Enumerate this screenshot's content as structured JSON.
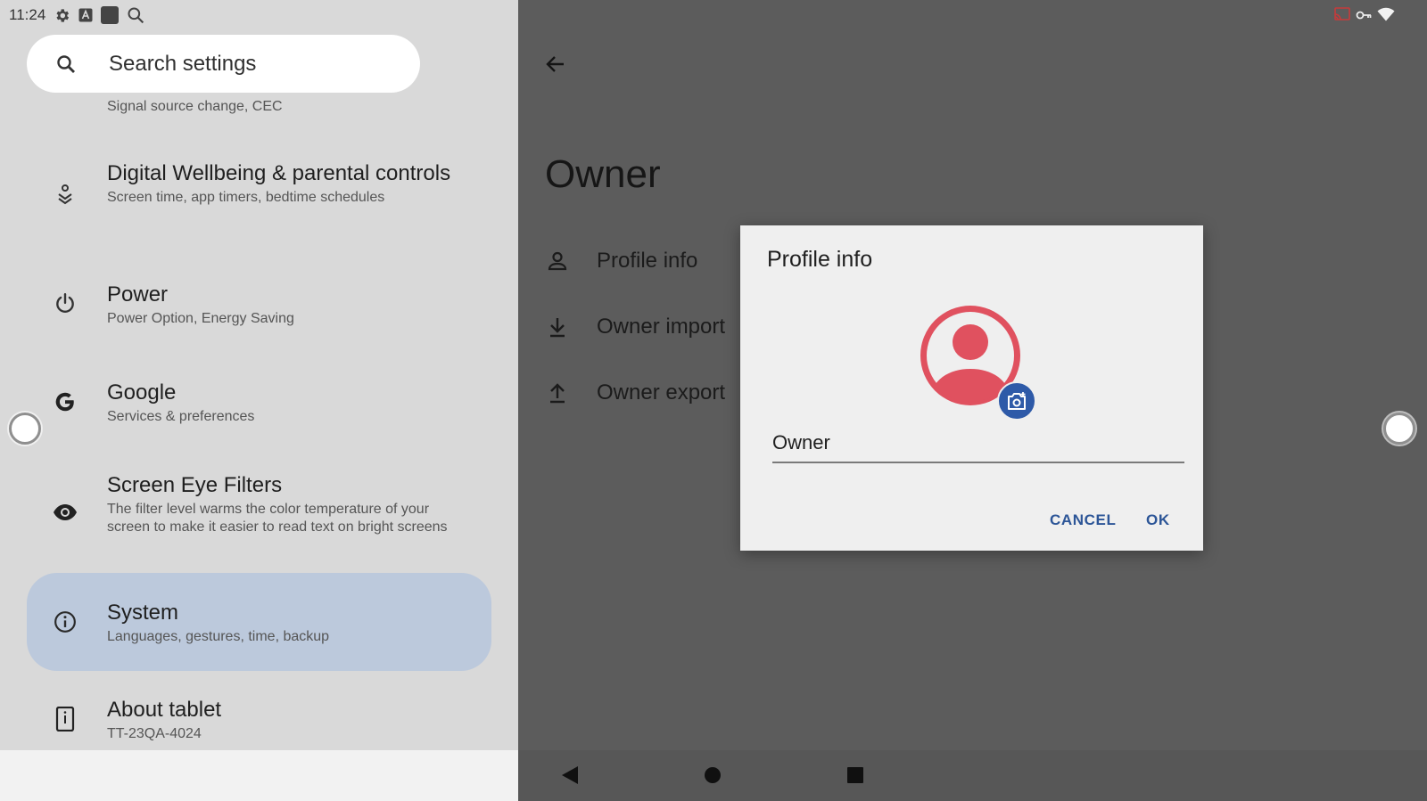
{
  "status_bar": {
    "time": "11:24",
    "left_icons": [
      "gear-icon",
      "a-icon",
      "square-icon",
      "search-icon"
    ],
    "right_icons": [
      "cast-icon",
      "vpn-key-icon",
      "wifi-icon"
    ]
  },
  "search": {
    "placeholder": "Search settings"
  },
  "settings_list": {
    "cut_subtitle": "Signal source change, CEC",
    "items": [
      {
        "title": "Digital Wellbeing & parental controls",
        "subtitle": "Screen time, app timers, bedtime schedules",
        "icon": "wellbeing-icon"
      },
      {
        "title": "Power",
        "subtitle": "Power Option, Energy Saving",
        "icon": "power-icon"
      },
      {
        "title": "Google",
        "subtitle": "Services & preferences",
        "icon": "google-icon"
      },
      {
        "title": "Screen Eye Filters",
        "subtitle": "The filter level warms the color temperature of your screen to make it easier to read text on bright screens",
        "icon": "eye-icon"
      },
      {
        "title": "System",
        "subtitle": "Languages, gestures, time, backup",
        "icon": "info-icon",
        "selected": true
      },
      {
        "title": "About tablet",
        "subtitle": "TT-23QA-4024",
        "icon": "tablet-icon"
      }
    ]
  },
  "owner_page": {
    "title": "Owner",
    "items": [
      {
        "label": "Profile info",
        "icon": "person-icon"
      },
      {
        "label": "Owner import",
        "icon": "download-icon"
      },
      {
        "label": "Owner export",
        "icon": "upload-icon"
      }
    ]
  },
  "dialog": {
    "title": "Profile info",
    "name_value": "Owner",
    "cancel_label": "CANCEL",
    "ok_label": "OK",
    "avatar_color": "#e0515f",
    "badge_color": "#2e5aa8",
    "accent_color": "#2c5597"
  },
  "nav": {
    "buttons": [
      "back-triangle-icon",
      "home-circle-icon",
      "recents-square-icon"
    ]
  }
}
